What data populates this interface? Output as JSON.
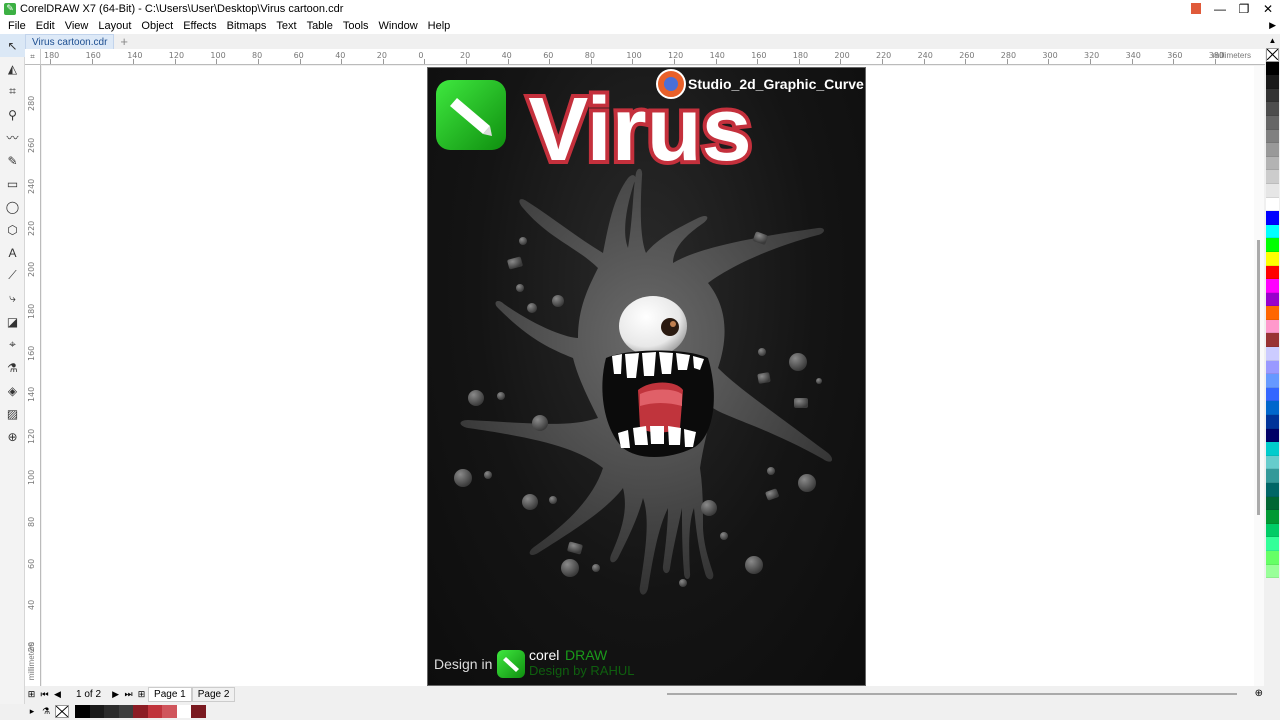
{
  "window": {
    "title": "CorelDRAW X7 (64-Bit) - C:\\Users\\User\\Desktop\\Virus cartoon.cdr",
    "minimize": "—",
    "maximize": "❐",
    "close": "✕"
  },
  "menu": [
    {
      "label": "File"
    },
    {
      "label": "Edit"
    },
    {
      "label": "View"
    },
    {
      "label": "Layout"
    },
    {
      "label": "Object"
    },
    {
      "label": "Effects"
    },
    {
      "label": "Bitmaps"
    },
    {
      "label": "Text"
    },
    {
      "label": "Table"
    },
    {
      "label": "Tools"
    },
    {
      "label": "Window"
    },
    {
      "label": "Help"
    }
  ],
  "document_tab": {
    "label": "Virus cartoon.cdr",
    "add": "+"
  },
  "ruler": {
    "unit": "millimeters",
    "h_labels": [
      "180",
      "160",
      "140",
      "120",
      "100",
      "80",
      "60",
      "40",
      "20",
      "0",
      "20",
      "40",
      "60",
      "80",
      "100",
      "120",
      "140",
      "160",
      "180",
      "200",
      "220",
      "240",
      "260",
      "280",
      "300",
      "320",
      "340",
      "360",
      "380"
    ],
    "v_labels": [
      "280",
      "260",
      "240",
      "220",
      "200",
      "180",
      "160",
      "140",
      "120",
      "100",
      "80",
      "60",
      "40",
      "20"
    ]
  },
  "artwork": {
    "title": "Virus",
    "watermark": "Studio_2d_Graphic_Curve",
    "design_in": "Design in",
    "brand_corel": "corel",
    "brand_draw": "DRAW",
    "design_by": "Design by RAHUL",
    "colors": {
      "title_fill": "#ffffff",
      "title_stroke": "#c4303c",
      "logo_green": "#22c822",
      "blob": "#4e4e4e",
      "tongue": "#c0343c"
    }
  },
  "status": {
    "page_count": "1 of 2",
    "pages": [
      {
        "label": "Page 1"
      },
      {
        "label": "Page 2"
      }
    ]
  },
  "palette_colors": [
    "#000000",
    "#1a1a1a",
    "#333333",
    "#4d4d4d",
    "#666666",
    "#808080",
    "#999999",
    "#b3b3b3",
    "#cccccc",
    "#e6e6e6",
    "#ffffff",
    "#0000ff",
    "#00ffff",
    "#00ff00",
    "#ffff00",
    "#ff0000",
    "#ff00ff",
    "#9900cc",
    "#ff6600",
    "#ff99cc",
    "#993333",
    "#ccccff",
    "#9999ff",
    "#6699ff",
    "#3366ff",
    "#0066cc",
    "#003399",
    "#000066",
    "#00cccc",
    "#66cccc",
    "#339999",
    "#006666",
    "#006633",
    "#009933",
    "#00cc66",
    "#33ff99",
    "#66ff66",
    "#99ff99"
  ],
  "document_colors": [
    "#000000",
    "#1a1a1a",
    "#2b2b2b",
    "#3d3d3d",
    "#8c1c24",
    "#c0343c",
    "#d0555c",
    "#ffffff",
    "#7a1a20"
  ]
}
